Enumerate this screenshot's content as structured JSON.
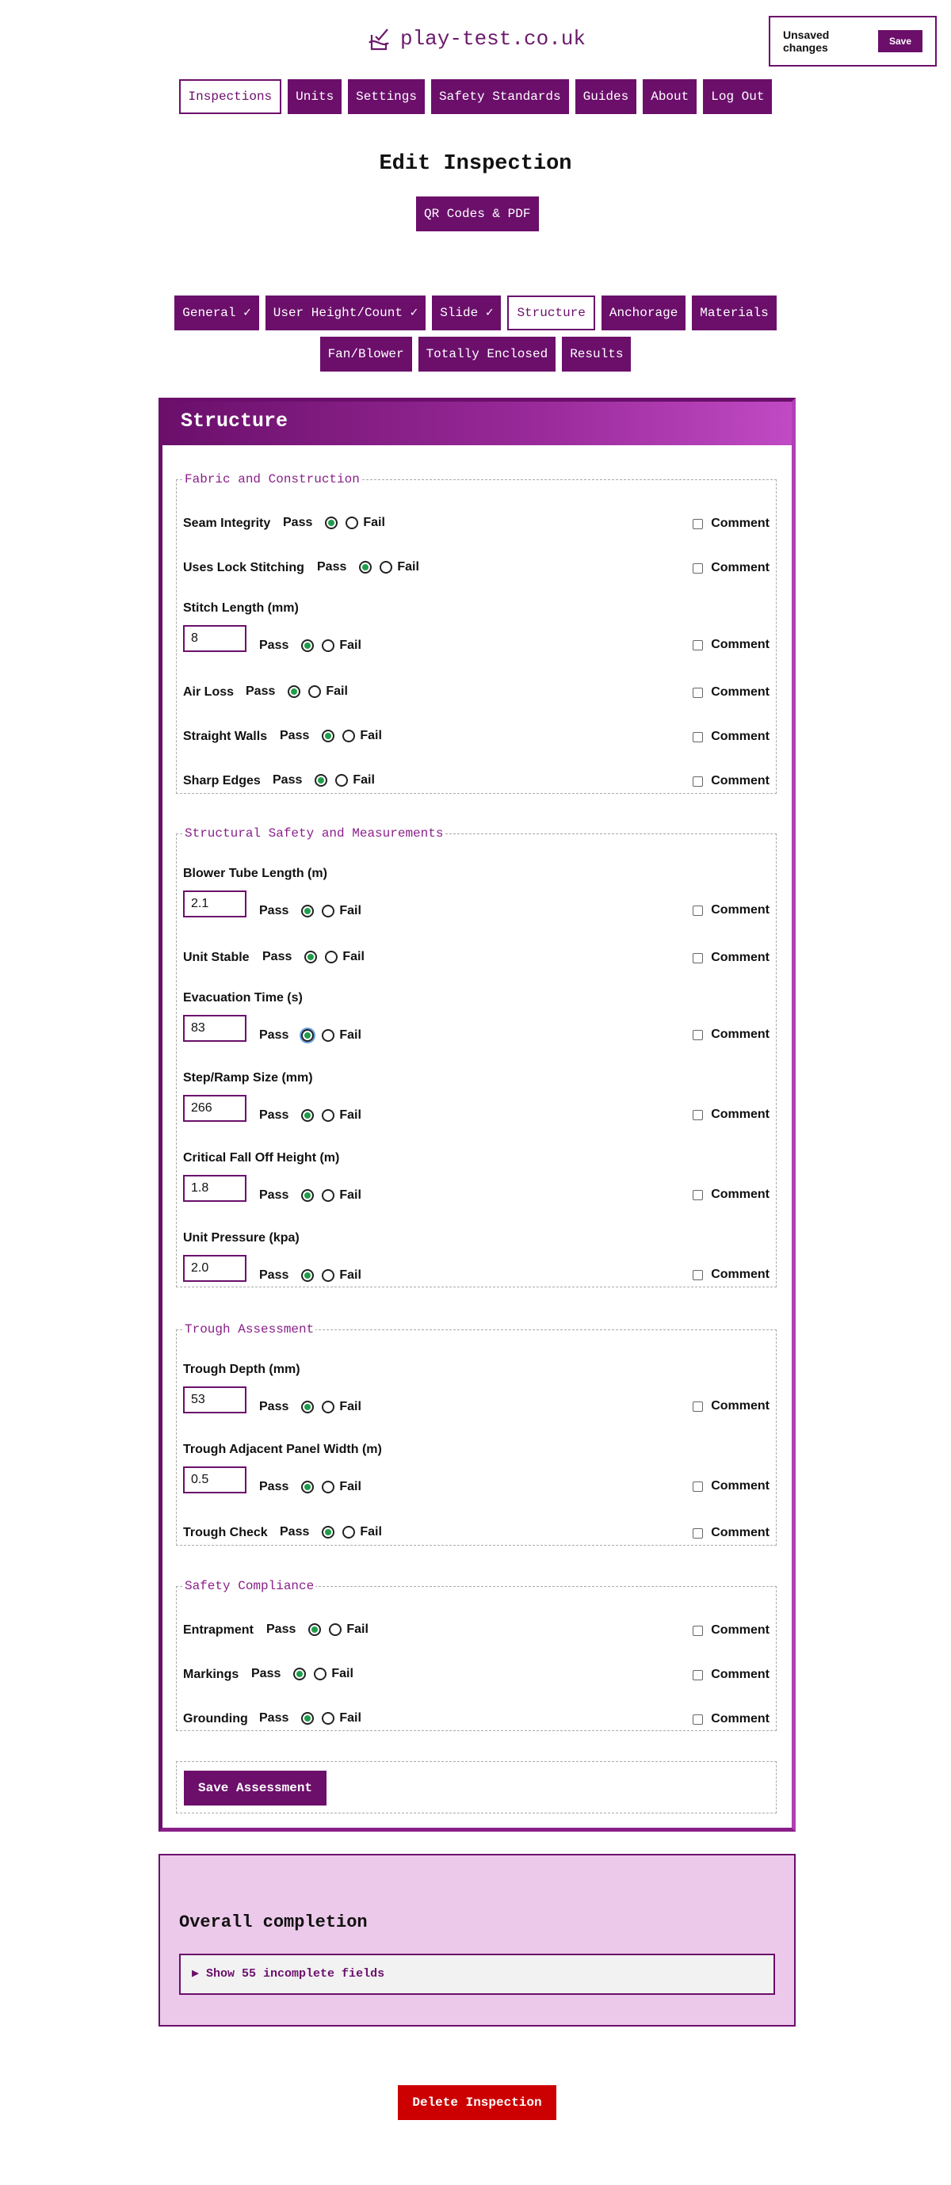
{
  "brand": {
    "name": "play-test.co.uk"
  },
  "unsaved": {
    "label": "Unsaved changes",
    "save": "Save"
  },
  "nav": [
    "Inspections",
    "Units",
    "Settings",
    "Safety Standards",
    "Guides",
    "About",
    "Log Out"
  ],
  "page": {
    "title": "Edit Inspection",
    "qr": "QR Codes & PDF"
  },
  "tabs": {
    "row1": [
      "General ✓",
      "User Height/Count ✓",
      "Slide ✓",
      "Structure",
      "Anchorage",
      "Materials"
    ],
    "row2": [
      "Fan/Blower",
      "Totally Enclosed",
      "Results"
    ]
  },
  "panel": {
    "title": "Structure"
  },
  "labels": {
    "pass": "Pass",
    "fail": "Fail",
    "comment": "Comment"
  },
  "sections": {
    "fabric": {
      "legend": "Fabric and Construction",
      "seam": "Seam Integrity",
      "lock": "Uses Lock Stitching",
      "stitch": "Stitch Length (mm)",
      "stitch_value": "8",
      "air": "Air Loss",
      "walls": "Straight Walls",
      "edges": "Sharp Edges"
    },
    "structural": {
      "legend": "Structural Safety and Measurements",
      "blower": "Blower Tube Length (m)",
      "blower_value": "2.1",
      "stable": "Unit Stable",
      "evac": "Evacuation Time (s)",
      "evac_value": "83",
      "step": "Step/Ramp Size (mm)",
      "step_value": "266",
      "fall": "Critical Fall Off Height (m)",
      "fall_value": "1.8",
      "pressure": "Unit Pressure (kpa)",
      "pressure_value": "2.0"
    },
    "trough": {
      "legend": "Trough Assessment",
      "depth": "Trough Depth (mm)",
      "depth_value": "53",
      "panel": "Trough Adjacent Panel Width (m)",
      "panel_value": "0.5",
      "check": "Trough Check"
    },
    "compliance": {
      "legend": "Safety Compliance",
      "entrapment": "Entrapment",
      "markings": "Markings",
      "grounding": "Grounding"
    }
  },
  "save_assessment": "Save Assessment",
  "completion": {
    "title": "Overall completion",
    "toggle": "▶ Show 55 incomplete fields"
  },
  "delete": "Delete Inspection",
  "colors": {
    "primary": "#6b0f6b",
    "pass_dot": "#1e9e4a",
    "danger": "#cc0000",
    "completion_bg": "#ecc9ea"
  }
}
